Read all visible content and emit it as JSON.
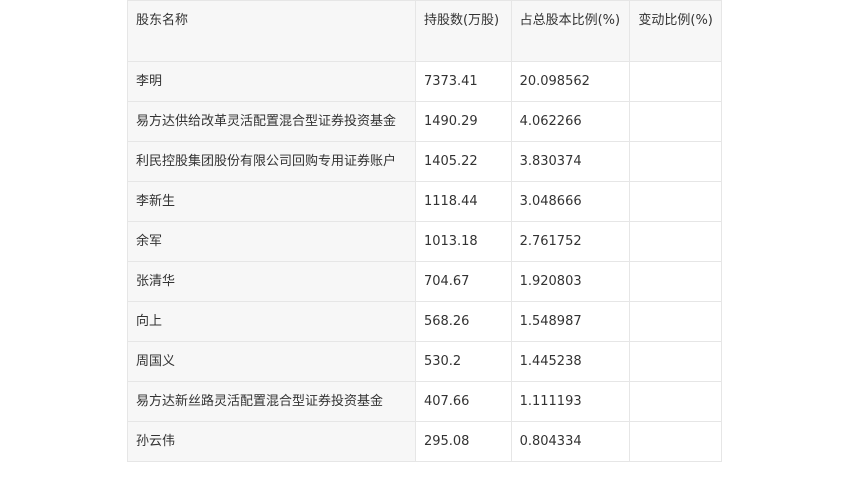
{
  "table": {
    "headers": {
      "name": "股东名称",
      "shares": "持股数(万股)",
      "ratio": "占总股本比例(%)",
      "change": "变动比例(%)"
    },
    "rows": [
      {
        "name": "李明",
        "shares": "7373.41",
        "ratio": "20.098562",
        "change": ""
      },
      {
        "name": "易方达供给改革灵活配置混合型证券投资基金",
        "shares": "1490.29",
        "ratio": "4.062266",
        "change": ""
      },
      {
        "name": "利民控股集团股份有限公司回购专用证券账户",
        "shares": "1405.22",
        "ratio": "3.830374",
        "change": ""
      },
      {
        "name": "李新生",
        "shares": "1118.44",
        "ratio": "3.048666",
        "change": ""
      },
      {
        "name": "余军",
        "shares": "1013.18",
        "ratio": "2.761752",
        "change": ""
      },
      {
        "name": "张清华",
        "shares": "704.67",
        "ratio": "1.920803",
        "change": ""
      },
      {
        "name": "向上",
        "shares": "568.26",
        "ratio": "1.548987",
        "change": ""
      },
      {
        "name": "周国义",
        "shares": "530.2",
        "ratio": "1.445238",
        "change": ""
      },
      {
        "name": "易方达新丝路灵活配置混合型证券投资基金",
        "shares": "407.66",
        "ratio": "1.111193",
        "change": ""
      },
      {
        "name": "孙云伟",
        "shares": "295.08",
        "ratio": "0.804334",
        "change": ""
      }
    ]
  }
}
